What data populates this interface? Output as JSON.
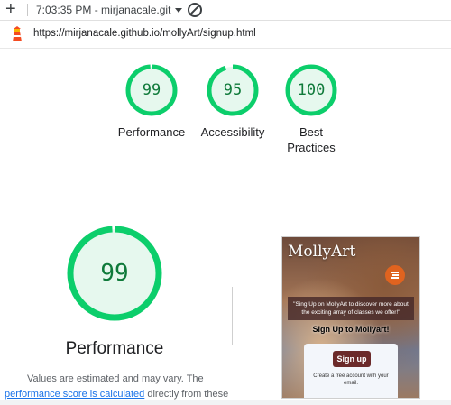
{
  "toolbar": {
    "plus": "+",
    "session_label": "7:03:35 PM - mirjanacale.githu"
  },
  "url": "https://mirjanacale.github.io/mollyArt/signup.html",
  "colors": {
    "pass": "#0cce6b",
    "pass_fill": "#e6f8ee",
    "pass_text": "#0f7a3a",
    "link": "#1a73e8"
  },
  "scores": [
    {
      "value": "99",
      "fraction": 0.99,
      "label": "Performance"
    },
    {
      "value": "95",
      "fraction": 0.95,
      "label": "Accessibility"
    },
    {
      "value": "100",
      "fraction": 1.0,
      "label_line1": "Best",
      "label_line2": "Practices"
    }
  ],
  "main_score": {
    "value": "99",
    "fraction": 0.99,
    "label": "Performance"
  },
  "description": {
    "line1": "Values are estimated and may vary. The",
    "link": "performance score is calculated",
    "line2_rest": " directly from these"
  },
  "thumbnail": {
    "brand": "MollyArt",
    "banner": "\"Sing Up on MollyArt to discover more about the exciting array of classes we offer!\"",
    "heading": "Sign Up to Mollyart!",
    "button": "Sign up",
    "card_text": "Create a free account with your email."
  },
  "icons": {
    "add": "plus-icon",
    "dropdown": "chevron-down-icon",
    "clear": "clear-icon",
    "logo": "lighthouse-icon",
    "menu": "hamburger-icon"
  }
}
